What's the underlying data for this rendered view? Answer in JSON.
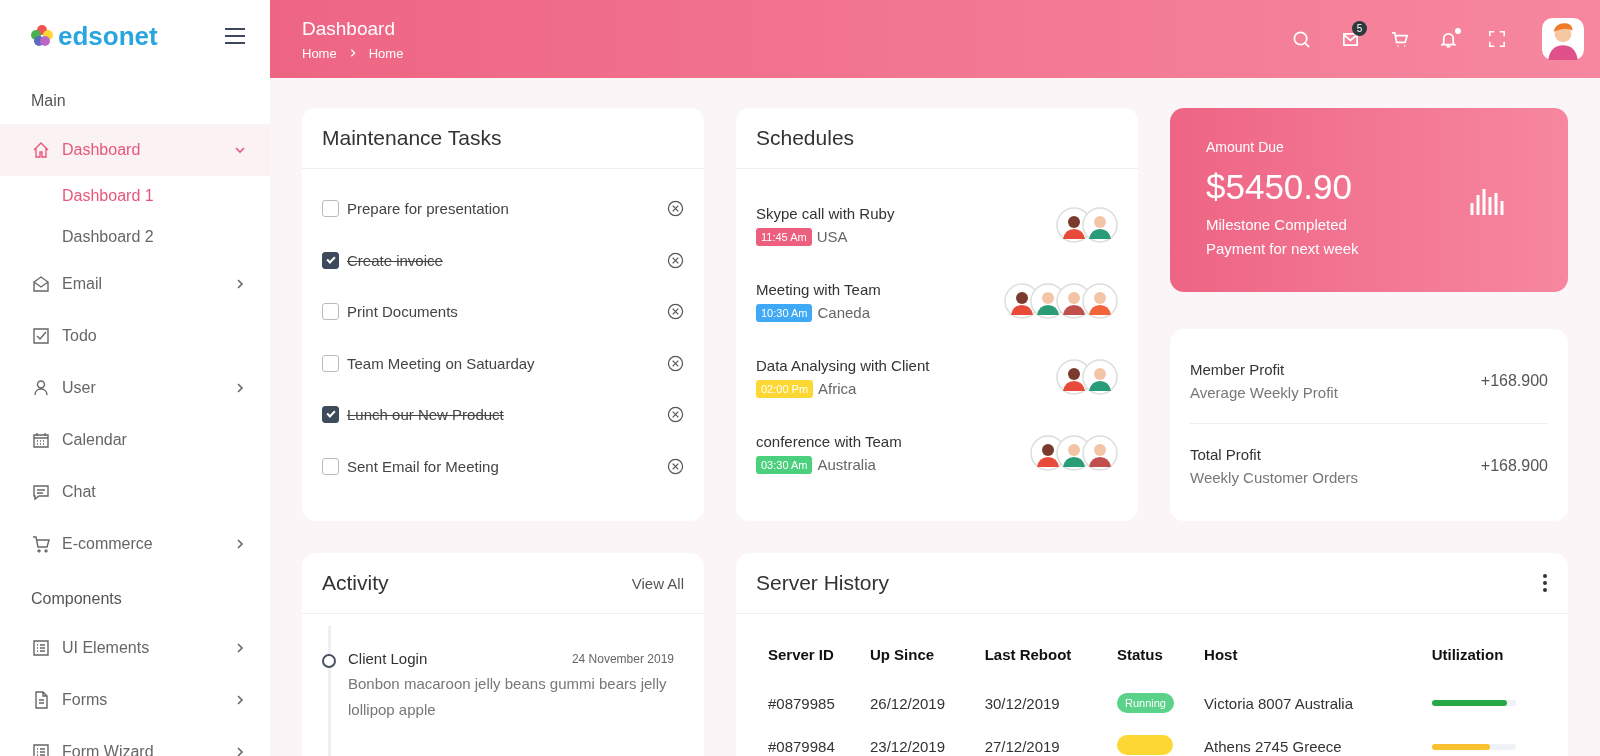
{
  "brand": {
    "name": "edsonet"
  },
  "sidebar": {
    "sections": [
      {
        "title": "Main",
        "items": [
          {
            "label": "Dashboard",
            "selected": true,
            "expanded": true,
            "children": [
              {
                "label": "Dashboard 1",
                "selected": true
              },
              {
                "label": "Dashboard 2",
                "selected": false
              }
            ]
          },
          {
            "label": "Email",
            "selected": false,
            "expanded": false
          },
          {
            "label": "Todo",
            "selected": false
          },
          {
            "label": "User",
            "selected": false,
            "expanded": false
          },
          {
            "label": "Calendar",
            "selected": false
          },
          {
            "label": "Chat",
            "selected": false
          },
          {
            "label": "E-commerce",
            "selected": false,
            "expanded": false
          }
        ]
      },
      {
        "title": "Components",
        "items": [
          {
            "label": "UI Elements",
            "selected": false,
            "expanded": false
          },
          {
            "label": "Forms",
            "selected": false,
            "expanded": false
          },
          {
            "label": "Form Wizard",
            "selected": false,
            "expanded": false
          }
        ]
      }
    ]
  },
  "header": {
    "title": "Dashboard",
    "breadcrumb": [
      "Home",
      "Home"
    ],
    "mail_count": "5",
    "notification_dot": true
  },
  "maintenance": {
    "title": "Maintenance Tasks",
    "tasks": [
      {
        "label": "Prepare for presentation",
        "checked": false
      },
      {
        "label": "Create invoice",
        "checked": true
      },
      {
        "label": "Print Documents",
        "checked": false
      },
      {
        "label": "Team Meeting on Satuarday",
        "checked": false
      },
      {
        "label": "Lunch our New Product",
        "checked": true
      },
      {
        "label": "Sent Email for Meeting",
        "checked": false
      }
    ]
  },
  "schedules": {
    "title": "Schedules",
    "items": [
      {
        "title": "Skype call with Ruby",
        "time": "11:45 Am",
        "place": "USA",
        "color": "#ec5f7e",
        "attendees": [
          {
            "color": "#e84a3c"
          },
          {
            "color": "#2a9d78"
          }
        ]
      },
      {
        "title": "Meeting with Team",
        "time": "10:30 Am",
        "place": "Caneda",
        "color": "#3fa9f5",
        "attendees": [
          {
            "color": "#e84a3c"
          },
          {
            "color": "#2a9d78"
          },
          {
            "color": "#c0504d"
          },
          {
            "color": "#f2643a"
          }
        ]
      },
      {
        "title": "Data Analysing with Client",
        "time": "02:00 Pm",
        "place": "Africa",
        "color": "#fdd835",
        "attendees": [
          {
            "color": "#e84a3c"
          },
          {
            "color": "#2a9d78"
          }
        ]
      },
      {
        "title": "conference with Team",
        "time": "03:30 Am",
        "place": "Australia",
        "color": "#4cd07d",
        "attendees": [
          {
            "color": "#e84a3c"
          },
          {
            "color": "#2a9d78"
          },
          {
            "color": "#c0504d"
          }
        ]
      }
    ]
  },
  "amount_due": {
    "label": "Amount Due",
    "value": "$5450.90",
    "line_1": "Milestone Completed",
    "line_2": "Payment for next week"
  },
  "profits": [
    {
      "title": "Member Profit",
      "subtitle": "Average Weekly Profit",
      "value": "+168.900"
    },
    {
      "title": "Total Profit",
      "subtitle": "Weekly Customer Orders",
      "value": "+168.900"
    }
  ],
  "activity": {
    "title": "Activity",
    "link": "View All",
    "items": [
      {
        "title": "Client Login",
        "date": "24 November 2019",
        "text": "Bonbon macaroon jelly beans gummi bears jelly lollipop apple"
      }
    ]
  },
  "server_history": {
    "title": "Server History",
    "columns": [
      "Server ID",
      "Up Since",
      "Last Reboot",
      "Status",
      "Host",
      "Utilization"
    ],
    "rows": [
      {
        "id": "#0879985",
        "up_since": "26/12/2019",
        "last_reboot": "30/12/2019",
        "status": {
          "label": "Running",
          "color": "#5bd28a"
        },
        "host": "Victoria 8007 Australia",
        "utilization": {
          "level": 0.9,
          "color": "#28a745"
        }
      },
      {
        "id": "#0879984",
        "up_since": "23/12/2019",
        "last_reboot": "27/12/2019",
        "status": {
          "color": "#fdd835"
        },
        "host": "Athens 2745 Greece",
        "utilization": {
          "level": 0.7,
          "color": "#fbc02d"
        }
      }
    ]
  }
}
